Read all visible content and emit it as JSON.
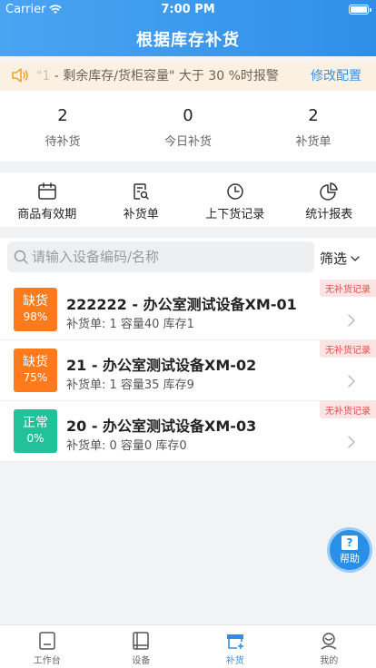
{
  "status_bar": {
    "carrier": "Carrier",
    "time": "7:00 PM"
  },
  "nav": {
    "title": "根据库存补货"
  },
  "notice": {
    "quote_prefix": "\"1",
    "text": " - 剩余库存/货柜容量\" 大于 30 %时报警",
    "link": "修改配置"
  },
  "stats": [
    {
      "value": "2",
      "label": "待补货"
    },
    {
      "value": "0",
      "label": "今日补货"
    },
    {
      "value": "2",
      "label": "补货单"
    }
  ],
  "menu": [
    {
      "label": "商品有效期",
      "icon": "calendar-icon"
    },
    {
      "label": "补货单",
      "icon": "doc-search-icon"
    },
    {
      "label": "上下货记录",
      "icon": "clock-icon"
    },
    {
      "label": "统计报表",
      "icon": "pie-chart-icon"
    }
  ],
  "search": {
    "placeholder": "请输入设备编码/名称",
    "filter_label": "筛选"
  },
  "devices": [
    {
      "status": "缺货",
      "percent": "98%",
      "color": "#ff7a1a",
      "title": "222222 - 办公室测试设备XM-01",
      "sub": "补货单: 1 容量40 库存1",
      "tag": "无补货记录"
    },
    {
      "status": "缺货",
      "percent": "75%",
      "color": "#ff7a1a",
      "title": "21 - 办公室测试设备XM-02",
      "sub": "补货单: 1 容量35 库存9",
      "tag": "无补货记录"
    },
    {
      "status": "正常",
      "percent": "0%",
      "color": "#21c29a",
      "title": "20 - 办公室测试设备XM-03",
      "sub": "补货单: 0 容量0 库存0",
      "tag": "无补货记录"
    }
  ],
  "help": {
    "icon_text": "?",
    "label": "帮助"
  },
  "tabs": [
    {
      "label": "工作台",
      "icon": "workbench-icon",
      "active": false
    },
    {
      "label": "设备",
      "icon": "device-icon",
      "active": false
    },
    {
      "label": "补货",
      "icon": "restock-icon",
      "active": true
    },
    {
      "label": "我的",
      "icon": "profile-icon",
      "active": false
    }
  ],
  "colors": {
    "primary": "#2f8fe8",
    "shortage": "#ff7a1a",
    "normal": "#21c29a",
    "tag_text": "#e84b4b"
  }
}
